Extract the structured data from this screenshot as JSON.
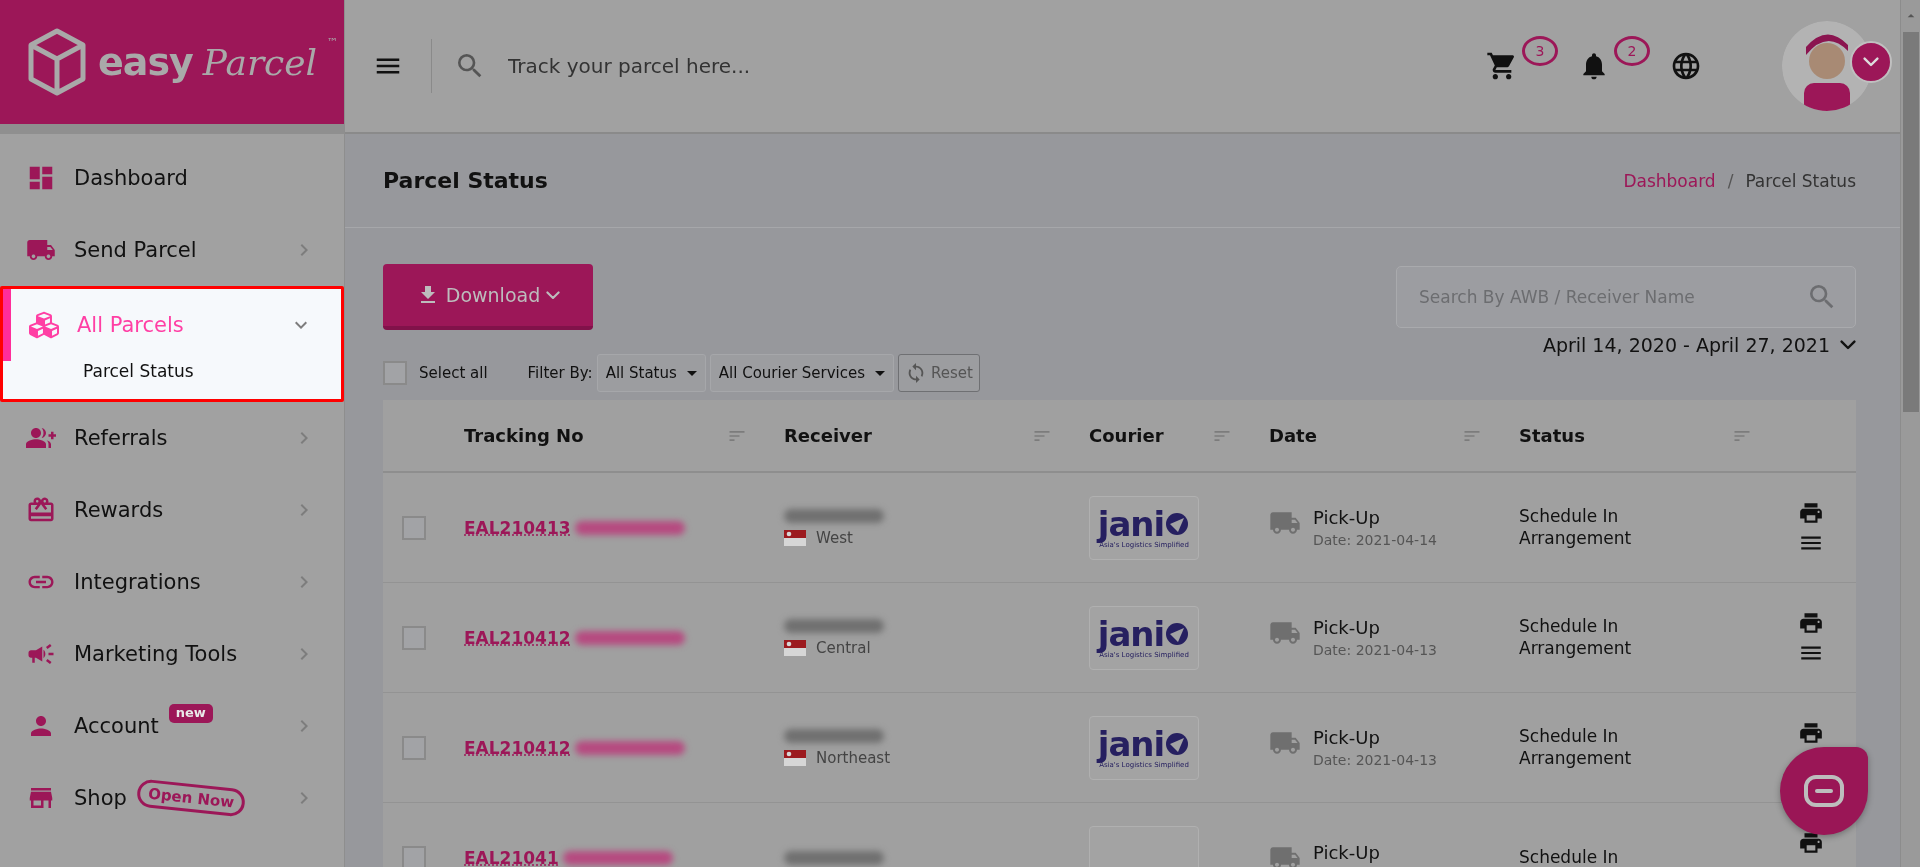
{
  "logo": {
    "part1": "easy",
    "part2": "Parcel",
    "trademark": "™"
  },
  "topbar": {
    "search_placeholder": "Track your parcel here...",
    "cart_count": "3",
    "notification_count": "2"
  },
  "sidebar": {
    "items": [
      {
        "label": "Dashboard",
        "has_submenu": false,
        "selected": false,
        "highlighted": false
      },
      {
        "label": "Send Parcel",
        "has_submenu": true,
        "expanded": false,
        "selected": false,
        "highlighted": false
      },
      {
        "label": "All Parcels",
        "has_submenu": true,
        "expanded": true,
        "selected": true,
        "highlighted": true,
        "children": [
          {
            "label": "Parcel Status"
          }
        ]
      },
      {
        "label": "Referrals",
        "has_submenu": true,
        "expanded": false,
        "selected": false,
        "highlighted": false
      },
      {
        "label": "Rewards",
        "has_submenu": true,
        "expanded": false,
        "selected": false,
        "highlighted": false
      },
      {
        "label": "Integrations",
        "has_submenu": true,
        "expanded": false,
        "selected": false,
        "highlighted": false
      },
      {
        "label": "Marketing Tools",
        "has_submenu": true,
        "expanded": false,
        "selected": false,
        "highlighted": false
      },
      {
        "label": "Account",
        "has_submenu": true,
        "expanded": false,
        "selected": false,
        "highlighted": false,
        "badge": {
          "text": "new",
          "kind": "filled"
        }
      },
      {
        "label": "Shop",
        "has_submenu": true,
        "expanded": false,
        "selected": false,
        "highlighted": false,
        "badge": {
          "text": "Open Now",
          "kind": "outline"
        }
      }
    ]
  },
  "page": {
    "title": "Parcel Status",
    "breadcrumb": [
      {
        "label": "Dashboard",
        "link": true
      },
      {
        "label": "Parcel Status",
        "link": false
      }
    ],
    "breadcrumb_separator": "/"
  },
  "toolbar": {
    "download_button": "Download",
    "search_placeholder": "Search By AWB / Receiver Name",
    "select_all": {
      "label": "Select all",
      "checked": false
    },
    "filter_label": "Filter By:",
    "filters": [
      "All Status",
      "All Courier Services"
    ],
    "reset_button": "Reset",
    "date_range": "April 14, 2020 - April 27, 2021"
  },
  "table": {
    "columns": [
      "Tracking No",
      "Receiver",
      "Courier",
      "Date",
      "Status"
    ],
    "rows": [
      {
        "tracking": "EAL210413",
        "region": "West",
        "courier": {
          "name": "jani",
          "tagline": "Asia's Logistics Simplified"
        },
        "date_type": "Pick-Up",
        "date": "Date: 2021-04-14",
        "status": "Schedule In Arrangement",
        "checked": false,
        "kind": "full"
      },
      {
        "tracking": "EAL210412",
        "region": "Central",
        "courier": {
          "name": "jani",
          "tagline": "Asia's Logistics Simplified"
        },
        "date_type": "Pick-Up",
        "date": "Date: 2021-04-13",
        "status": "Schedule In Arrangement",
        "checked": false,
        "kind": "full"
      },
      {
        "tracking": "EAL210412",
        "region": "Northeast",
        "courier": {
          "name": "jani",
          "tagline": "Asia's Logistics Simplified"
        },
        "date_type": "Pick-Up",
        "date": "Date: 2021-04-13",
        "status": "Schedule In Arrangement",
        "checked": false,
        "kind": "covered"
      },
      {
        "tracking": "EAL21041",
        "date_type": "Pick-Up",
        "status": "Schedule In",
        "checked": false,
        "kind": "covered"
      }
    ]
  }
}
